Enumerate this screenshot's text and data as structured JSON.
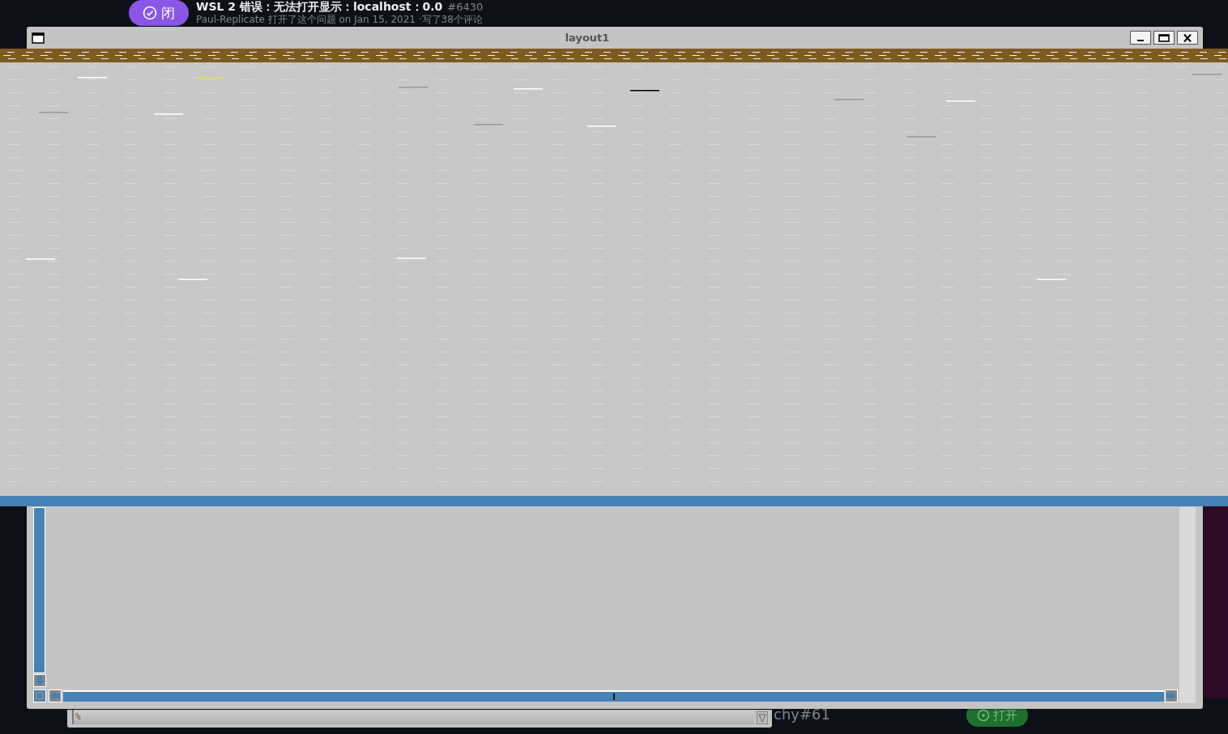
{
  "issue": {
    "state_label": "闭",
    "title": "WSL 2 错误：无法打开显示：localhost：0.0",
    "number": "#6430",
    "meta": "Paul-Replicate 打开了这个问题 on Jan 15, 2021 ·写了38个评论"
  },
  "console": {
    "prompt": "%"
  },
  "background": {
    "reference": "chy#61",
    "open_label": "打开"
  },
  "window": {
    "title": "layout1"
  }
}
